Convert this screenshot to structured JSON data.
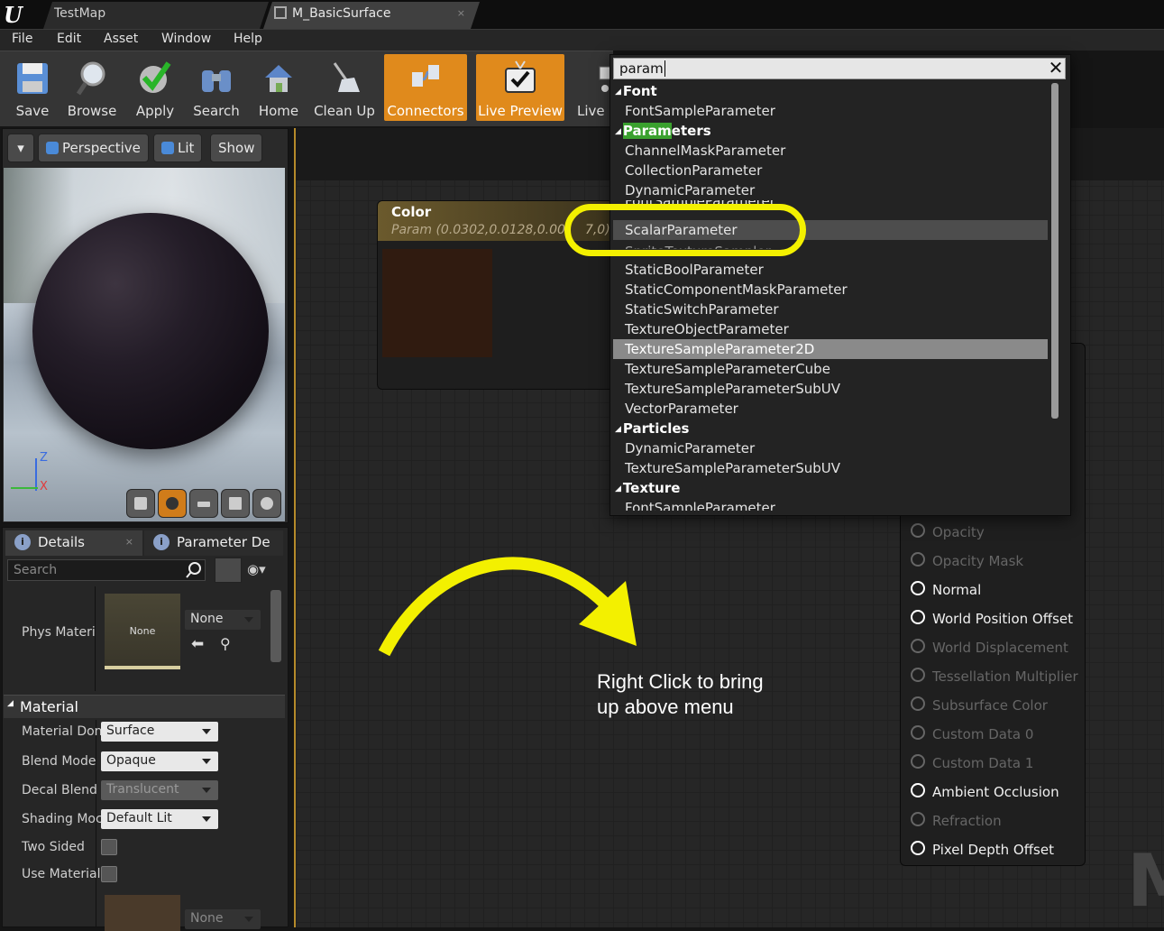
{
  "window": {
    "tabs": [
      {
        "label": "TestMap"
      },
      {
        "label": "M_BasicSurface"
      }
    ]
  },
  "menu": [
    "File",
    "Edit",
    "Asset",
    "Window",
    "Help"
  ],
  "toolbar": {
    "buttons": [
      {
        "label": "Save",
        "icon": "floppy-disk-icon"
      },
      {
        "label": "Browse",
        "icon": "magnifier-icon"
      },
      {
        "label": "Apply",
        "icon": "checkmark-icon"
      },
      {
        "label": "Search",
        "icon": "binoculars-icon"
      },
      {
        "label": "Home",
        "icon": "house-icon"
      },
      {
        "label": "Clean Up",
        "icon": "broom-icon"
      },
      {
        "label": "Connectors",
        "icon": "connectors-icon",
        "active": true
      },
      {
        "label": "Live Preview",
        "icon": "tv-check-icon",
        "active": true
      },
      {
        "label": "Live",
        "icon": "live-nodes-icon"
      }
    ],
    "accent": "#e08a1c"
  },
  "viewport": {
    "buttons": [
      "Perspective",
      "Lit",
      "Show"
    ],
    "axes": [
      "Z",
      "X"
    ]
  },
  "details": {
    "tabs": [
      "Details",
      "Parameter De"
    ],
    "search_placeholder": "Search",
    "phys_material_label": "Phys Materi",
    "phys_material_thumb": "None",
    "phys_material_value": "None",
    "material_section": "Material",
    "rows": [
      {
        "label": "Material Don",
        "value": "Surface"
      },
      {
        "label": "Blend Mode",
        "value": "Opaque"
      },
      {
        "label": "Decal Blend",
        "value": "Translucent"
      },
      {
        "label": "Shading Moc",
        "value": "Default Lit"
      }
    ],
    "two_sided": "Two Sided",
    "use_material": "Use Material",
    "bottom_none": "None"
  },
  "graph": {
    "color_node": {
      "title": "Color",
      "subtitle": "Param (0.0302,0.0128,0.00",
      "subtitle_end": "7,0)",
      "swatch": "#301b10"
    },
    "result_pins": [
      {
        "label": "Opacity",
        "enabled": false
      },
      {
        "label": "Opacity Mask",
        "enabled": false
      },
      {
        "label": "Normal",
        "enabled": true
      },
      {
        "label": "World Position Offset",
        "enabled": true
      },
      {
        "label": "World Displacement",
        "enabled": false
      },
      {
        "label": "Tessellation Multiplier",
        "enabled": false
      },
      {
        "label": "Subsurface Color",
        "enabled": false
      },
      {
        "label": "Custom Data 0",
        "enabled": false
      },
      {
        "label": "Custom Data 1",
        "enabled": false
      },
      {
        "label": "Ambient Occlusion",
        "enabled": true
      },
      {
        "label": "Refraction",
        "enabled": false
      },
      {
        "label": "Pixel Depth Offset",
        "enabled": true
      }
    ],
    "watermark": "M"
  },
  "popup": {
    "search_value": "param",
    "items": [
      {
        "type": "cat",
        "label": "Font"
      },
      {
        "type": "item",
        "label": "FontSampleParameter"
      },
      {
        "type": "cat",
        "label": "Parameters",
        "highlight_prefix": "Param",
        "rest": "eters"
      },
      {
        "type": "item",
        "label": "ChannelMaskParameter"
      },
      {
        "type": "item",
        "label": "CollectionParameter"
      },
      {
        "type": "item",
        "label": "DynamicParameter"
      },
      {
        "type": "item",
        "label": "FontSampleParameter"
      },
      {
        "type": "item",
        "label": "ScalarParameter",
        "hover": true
      },
      {
        "type": "item",
        "label": "SpriteTextureSampler"
      },
      {
        "type": "item",
        "label": "StaticBoolParameter"
      },
      {
        "type": "item",
        "label": "StaticComponentMaskParameter"
      },
      {
        "type": "item",
        "label": "StaticSwitchParameter"
      },
      {
        "type": "item",
        "label": "TextureObjectParameter"
      },
      {
        "type": "item",
        "label": "TextureSampleParameter2D",
        "selected": true
      },
      {
        "type": "item",
        "label": "TextureSampleParameterCube"
      },
      {
        "type": "item",
        "label": "TextureSampleParameterSubUV"
      },
      {
        "type": "item",
        "label": "VectorParameter"
      },
      {
        "type": "cat",
        "label": "Particles"
      },
      {
        "type": "item",
        "label": "DynamicParameter"
      },
      {
        "type": "item",
        "label": "TextureSampleParameterSubUV"
      },
      {
        "type": "cat",
        "label": "Texture"
      },
      {
        "type": "item",
        "label": "FontSampleParameter"
      }
    ]
  },
  "annotation": {
    "line1": "Right Click to bring",
    "line2": "up above menu",
    "color": "#f3f000"
  }
}
